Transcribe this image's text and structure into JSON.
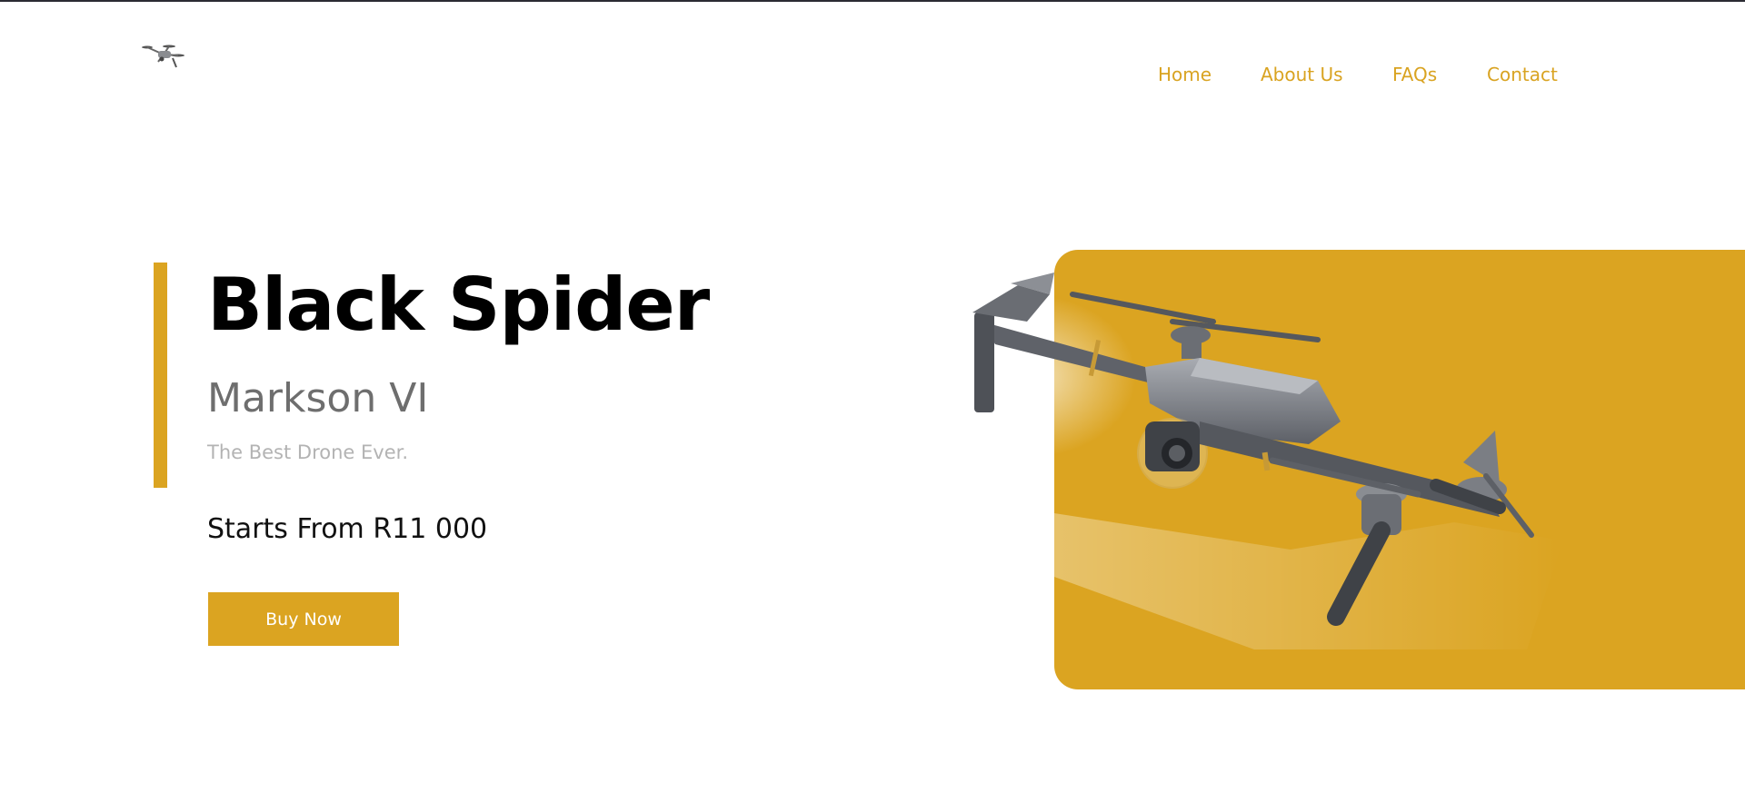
{
  "brand": {
    "accent": "#dba421",
    "logo_icon": "drone-logo-icon"
  },
  "nav": {
    "items": [
      {
        "label": "Home"
      },
      {
        "label": "About Us"
      },
      {
        "label": "FAQs"
      },
      {
        "label": "Contact"
      }
    ]
  },
  "hero": {
    "title": "Black Spider",
    "subtitle": "Markson VI",
    "tagline": "The Best Drone Ever.",
    "price": "Starts From R11 000",
    "cta_label": "Buy Now",
    "image": "drone-product-image"
  }
}
